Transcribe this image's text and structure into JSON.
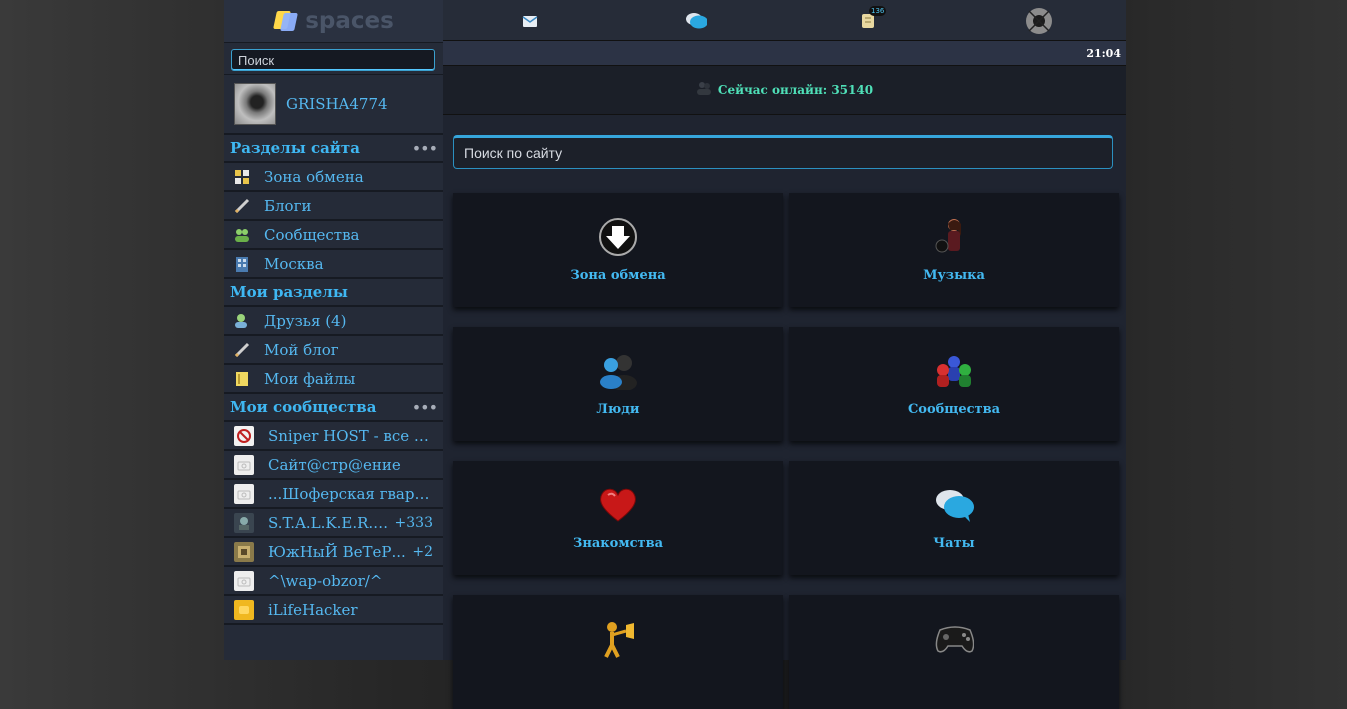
{
  "logo": {
    "text": "spaces"
  },
  "sidebar": {
    "search_placeholder": "Поиск",
    "user": {
      "name": "GRISHA4774"
    },
    "sections": [
      {
        "title": "Разделы сайта",
        "more": "•••",
        "items": [
          {
            "label": "Зона обмена",
            "icon": "grid-icon"
          },
          {
            "label": "Блоги",
            "icon": "pen-icon"
          },
          {
            "label": "Сообщества",
            "icon": "group-icon"
          },
          {
            "label": "Москва",
            "icon": "building-icon"
          }
        ]
      },
      {
        "title": "Мои разделы",
        "items": [
          {
            "label": "Друзья (4)",
            "icon": "friends-icon"
          },
          {
            "label": "Мой блог",
            "icon": "pen-icon"
          },
          {
            "label": "Мои файлы",
            "icon": "files-icon"
          }
        ]
      },
      {
        "title": "Мои сообщества",
        "more": "•••",
        "items": [
          {
            "label": "Sniper HOST - все для веб-мастеров",
            "display": "Sniper HOST - все дл...",
            "badge": ""
          },
          {
            "label": "Сайт@стр@ение",
            "display": "Сайт@стр@ение",
            "badge": ""
          },
          {
            "label": "...Шоферская гвардия",
            "display": "...Шоферская гварди...",
            "badge": ""
          },
          {
            "label": "S.T.A.L.K.E.R.",
            "display": "S.T.A.L.K.E.R. ...",
            "badge": "+333"
          },
          {
            "label": "ЮжНыЙ ВеТеР",
            "display": "ЮжНыЙ ВеТеР...",
            "badge": "+2"
          },
          {
            "label": "^\\wap-obzor/^",
            "display": "^\\wap-obzor/^",
            "badge": ""
          },
          {
            "label": "iLifeHacker",
            "display": "iLifeHacker",
            "badge": ""
          }
        ]
      }
    ]
  },
  "topbar": {
    "icons": [
      "mail-icon",
      "chat-icon",
      "notifications-icon",
      "avatar"
    ],
    "notification_count": "136"
  },
  "time": "21:04",
  "online": {
    "label": "Сейчас онлайн: 35140"
  },
  "site_search": {
    "placeholder": "Поиск по сайту"
  },
  "tiles": [
    {
      "label": "Зона обмена",
      "icon": "download-icon"
    },
    {
      "label": "Музыка",
      "icon": "music-icon"
    },
    {
      "label": "Люди",
      "icon": "people-icon"
    },
    {
      "label": "Сообщества",
      "icon": "communities-icon"
    },
    {
      "label": "Знакомства",
      "icon": "heart-icon"
    },
    {
      "label": "Чаты",
      "icon": "chat-bubbles-icon"
    },
    {
      "label": "",
      "icon": "trumpet-figure-icon"
    },
    {
      "label": "",
      "icon": "gamepad-icon"
    }
  ]
}
